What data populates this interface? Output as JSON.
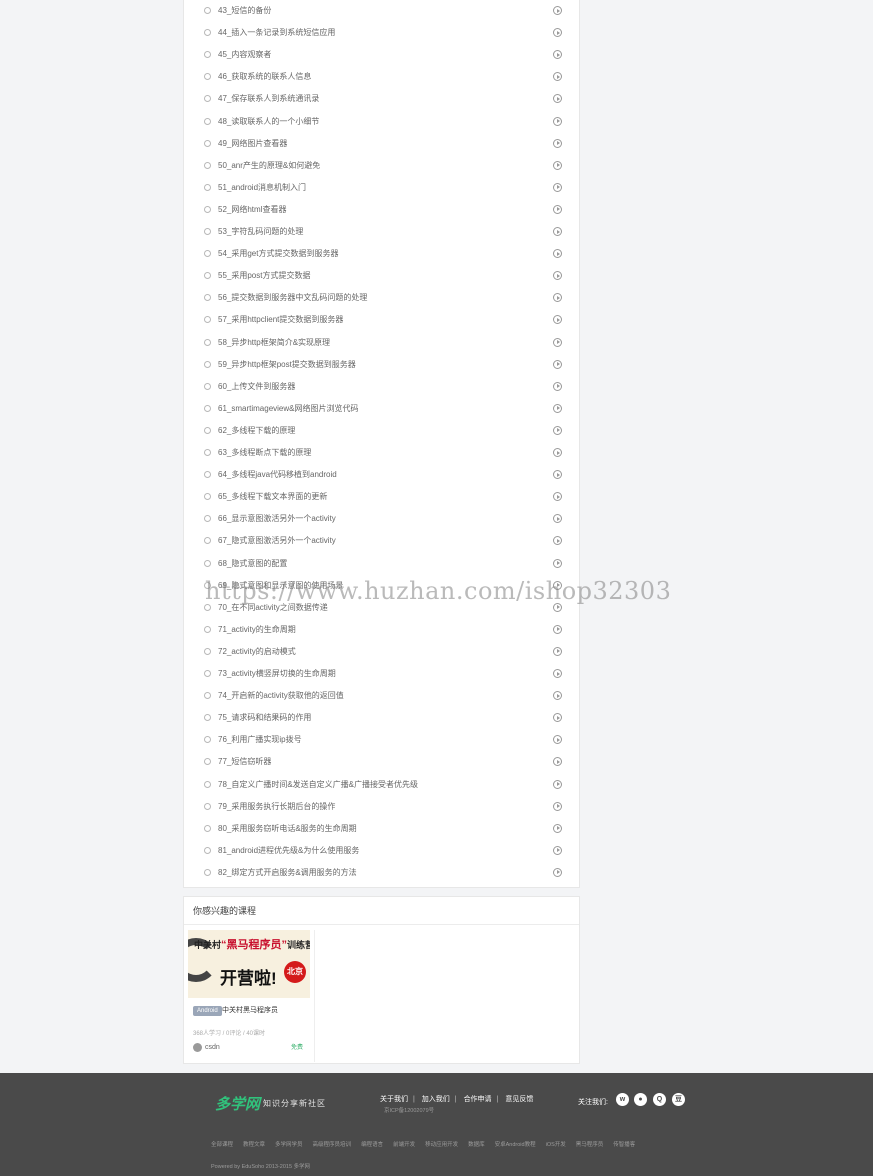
{
  "lessons": [
    "43_短信的备份",
    "44_插入一条记录到系统短信应用",
    "45_内容观察者",
    "46_获取系统的联系人信息",
    "47_保存联系人到系统通讯录",
    "48_读取联系人的一个小细节",
    "49_网络图片查看器",
    "50_anr产生的原理&如何避免",
    "51_android消息机制入门",
    "52_网络html查看器",
    "53_字符乱码问题的处理",
    "54_采用get方式提交数据到服务器",
    "55_采用post方式提交数据",
    "56_提交数据到服务器中文乱码问题的处理",
    "57_采用httpclient提交数据到服务器",
    "58_异步http框架简介&实现原理",
    "59_异步http框架post提交数据到服务器",
    "60_上传文件到服务器",
    "61_smartimageview&网络图片浏览代码",
    "62_多线程下载的原理",
    "63_多线程断点下载的原理",
    "64_多线程java代码移植到android",
    "65_多线程下载文本界面的更新",
    "66_显示意图激活另外一个activity",
    "67_隐式意图激活另外一个activity",
    "68_隐式意图的配置",
    "69_隐式意图和显示意图的使用场景",
    "70_在不同activity之间数据传递",
    "71_activity的生命周期",
    "72_activity的启动模式",
    "73_activity横竖屏切换的生命周期",
    "74_开启新的activity获取他的返回值",
    "75_请求码和结果码的作用",
    "76_利用广播实现ip拨号",
    "77_短信窃听器",
    "78_自定义广播时间&发送自定义广播&广播接受者优先级",
    "79_采用服务执行长期后台的操作",
    "80_采用服务窃听电话&服务的生命周期",
    "81_android进程优先级&为什么使用服务",
    "82_绑定方式开启服务&调用服务的方法"
  ],
  "courses_section": {
    "title": "你感兴趣的课程",
    "course": {
      "thumb_line1_prefix": "中关村",
      "thumb_line1_highlight": "“黑马程序员”",
      "thumb_line1_suffix": "训练营",
      "thumb_line2": "开营啦!",
      "thumb_badge": "北京",
      "tag": "Android",
      "name": "中关村黑马程序员",
      "meta": "368人学习 / 0评论 / 40课时",
      "author": "csdn",
      "price": "免费",
      "price_color": "#3cb371"
    }
  },
  "watermark": "https://www.huzhan.com/ishop32303",
  "footer": {
    "logo": "多学网",
    "slogan": "知识分享新社区",
    "links": [
      "关于我们",
      "加入我们",
      "合作申请",
      "意见反馈"
    ],
    "icp": "京ICP备12002079号",
    "follow_label": "关注我们:",
    "social_icons": [
      "weibo-icon",
      "wechat-icon",
      "qq-icon",
      "douban-icon"
    ],
    "nav": [
      "全部课程",
      "教程文章",
      "多学网学员",
      "高级程序员培训",
      "编程语言",
      "前端开发",
      "移动应用开发",
      "数据库",
      "安卓Android教程",
      "iOS开发",
      "黑马程序员",
      "传智播客"
    ],
    "powered": "Powered by EduSoho 2013-2015 多学网",
    "brand_color": "#31c27c"
  }
}
